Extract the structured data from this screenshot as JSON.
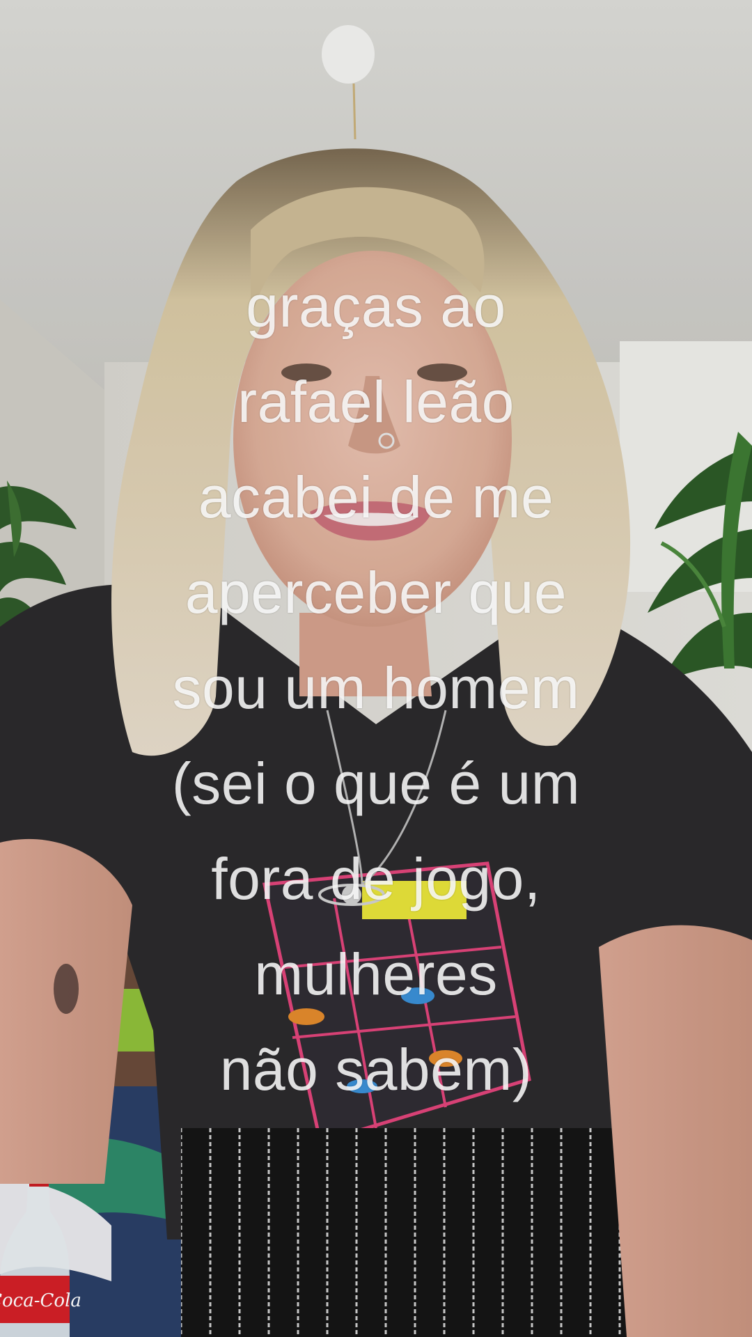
{
  "caption": {
    "lines": [
      "graças ao",
      "rafael leão",
      "acabei de me",
      "aperceber que",
      "sou um homem",
      "(sei o que é um",
      "fora de jogo,",
      "mulheres",
      "não sabem)"
    ]
  },
  "scene": {
    "bottle_label": "Coca-Cola"
  }
}
